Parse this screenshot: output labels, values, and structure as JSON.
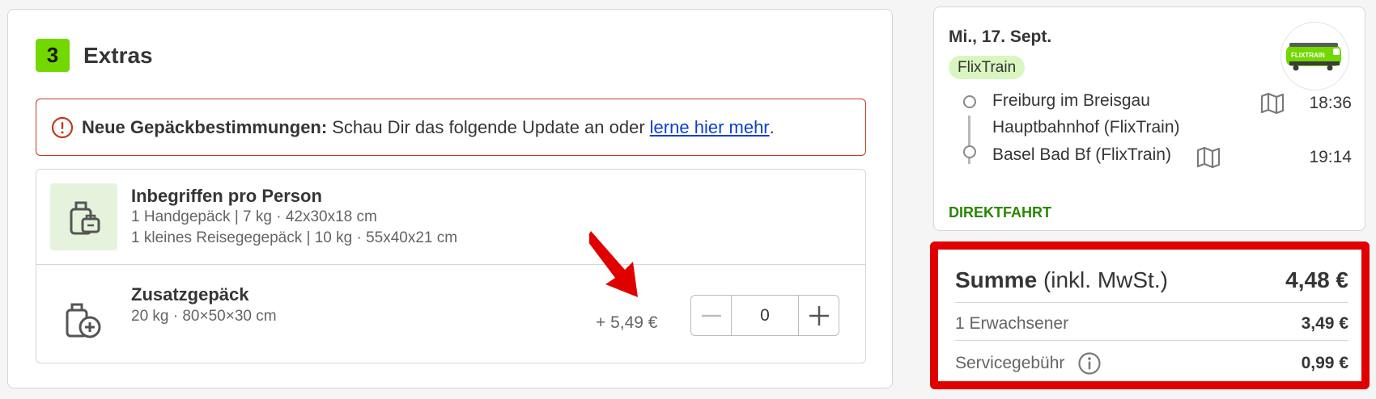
{
  "extras": {
    "step_number": "3",
    "title": "Extras",
    "notice": {
      "bold": "Neue Gepäckbestimmungen:",
      "text": "Schau Dir das folgende Update an oder",
      "link": "lerne hier mehr",
      "period": "."
    },
    "included": {
      "title": "Inbegriffen pro Person",
      "line1": "1 Handgepäck | 7 kg · 42x30x18 cm",
      "line2": "1 kleines Reisegegepäck | 10 kg · 55x40x21 cm"
    },
    "additional": {
      "title": "Zusatzgepäck",
      "subtitle": "20 kg · 80×50×30 cm",
      "price": "+ 5,49 €",
      "quantity": "0"
    }
  },
  "trip": {
    "date": "Mi., 17. Sept.",
    "badge": "FlixTrain",
    "logo_text": "FLIXTRAIN",
    "departure": {
      "name_line1": "Freiburg im Breisgau",
      "name_line2": "Hauptbahnhof (FlixTrain)",
      "time": "18:36"
    },
    "arrival": {
      "name": "Basel Bad Bf (FlixTrain)",
      "time": "19:14"
    },
    "direct_label": "DIREKTFAHRT"
  },
  "summary": {
    "title_bold": "Summe",
    "title_rest": "(inkl. MwSt.)",
    "total": "4,48 €",
    "lines": [
      {
        "label": "1 Erwachsener",
        "value": "3,49 €"
      },
      {
        "label": "Servicegebühr",
        "value": "0,99 €"
      }
    ]
  },
  "colors": {
    "brand_green": "#73d700",
    "notice_border": "#c6381d",
    "link_blue": "#0b3fd6",
    "direct_green": "#2a8600",
    "highlight_red": "#e00000"
  }
}
